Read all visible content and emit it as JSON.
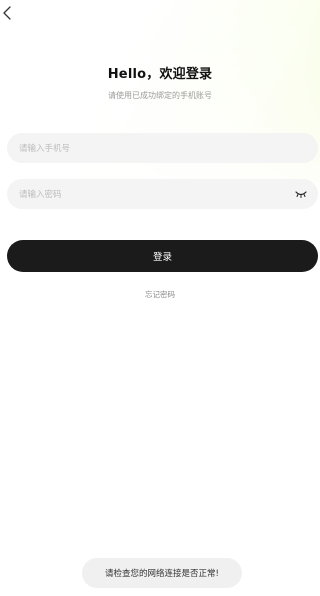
{
  "header": {
    "title": "Hello，欢迎登录",
    "subtitle": "请使用已成功绑定的手机账号"
  },
  "form": {
    "phone_placeholder": "请输入手机号",
    "phone_value": "",
    "password_placeholder": "请输入密码",
    "password_value": "",
    "login_label": "登录",
    "forgot_label": "忘记密码"
  },
  "toast": {
    "message": "请检查您的网络连接是否正常!"
  },
  "icons": {
    "back": "chevron-left-icon",
    "password_visibility": "eye-closed-icon"
  },
  "colors": {
    "primary_button": "#1b1b1b",
    "field_background": "#f4f4f4",
    "gradient_accent": "#f1f9c8"
  }
}
